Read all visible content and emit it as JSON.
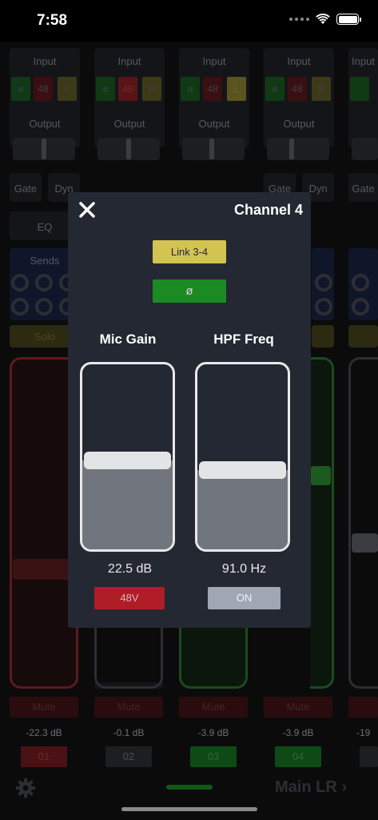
{
  "status_bar": {
    "time": "7:58"
  },
  "mixer": {
    "section_labels": {
      "input": "Input",
      "output": "Output",
      "gate": "Gate",
      "dyn": "Dyn",
      "eq": "EQ",
      "sends": "Sends",
      "solo": "Solo",
      "mute": "Mute"
    },
    "channels": [
      {
        "input_toggle": "ø",
        "phantom": "48",
        "link": "L",
        "db": "-22.3 dB",
        "number": "01",
        "color": "#e23a3a",
        "level": 0.0
      },
      {
        "input_toggle": "ø",
        "phantom": "48",
        "link": "R",
        "db": "-0.1 dB",
        "number": "02",
        "color": "#3a3d42",
        "level": 0.0
      },
      {
        "input_toggle": "ø",
        "phantom": "48",
        "link": "L",
        "db": "-3.9 dB",
        "number": "03",
        "color": "#2ea33a",
        "level": 0.0
      },
      {
        "input_toggle": "ø",
        "phantom": "48",
        "link": "R",
        "db": "-3.9 dB",
        "number": "04",
        "color": "#2ea33a",
        "level": 0.0
      },
      {
        "db": "-19",
        "number": ""
      }
    ],
    "main_bus": "Main LR",
    "main_bus_chevron": "›"
  },
  "modal": {
    "title": "Channel 4",
    "link_button": "Link 3-4",
    "phase_button": "ø",
    "mic_gain": {
      "label": "Mic Gain",
      "value": "22.5 dB",
      "level": 0.48
    },
    "hpf": {
      "label": "HPF Freq",
      "value": "91.0 Hz",
      "level": 0.43
    },
    "phantom_button": "48V",
    "hpf_button": "ON"
  },
  "colors": {
    "modal_bg": "#242833",
    "link_active": "#d3c452",
    "phase_active": "#1c8a24",
    "phantom_active": "#b11d27",
    "hpf_on": "#a0a7b4"
  }
}
